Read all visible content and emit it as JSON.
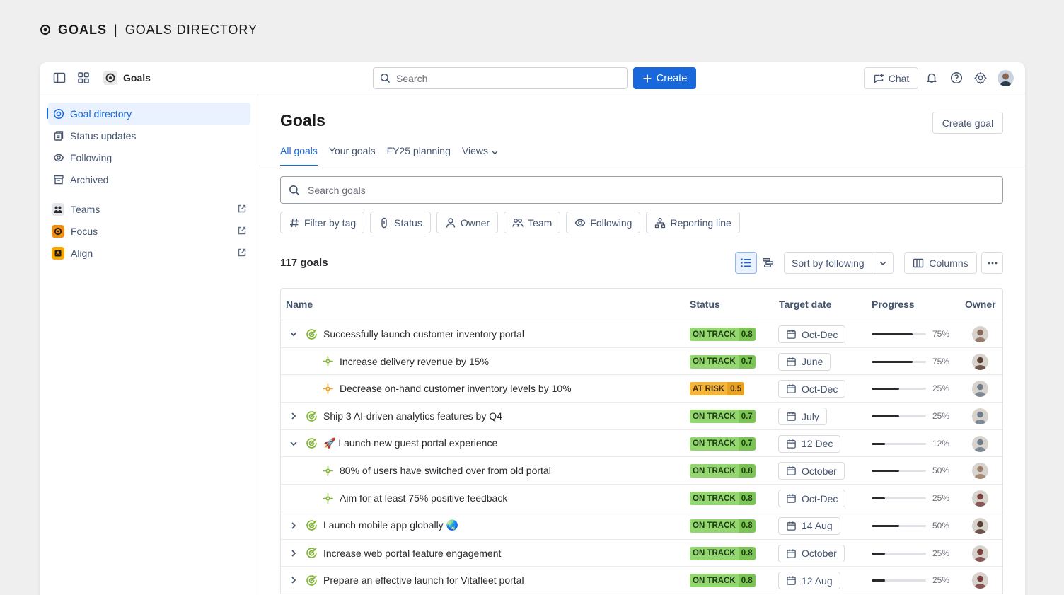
{
  "slide": {
    "title_bold": "GOALS",
    "separator": "|",
    "title_rest": "GOALS DIRECTORY"
  },
  "topbar": {
    "app_name": "Goals",
    "search_placeholder": "Search",
    "create_label": "Create",
    "chat_label": "Chat"
  },
  "sidebar": {
    "items": [
      {
        "label": "Goal directory",
        "icon": "goal-icon",
        "active": true
      },
      {
        "label": "Status updates",
        "icon": "status-updates-icon"
      },
      {
        "label": "Following",
        "icon": "eye-icon"
      },
      {
        "label": "Archived",
        "icon": "archive-icon"
      }
    ],
    "apps": [
      {
        "label": "Teams",
        "icon": "teams-icon"
      },
      {
        "label": "Focus",
        "icon": "focus-icon",
        "color": "#f18d13"
      },
      {
        "label": "Align",
        "icon": "align-icon",
        "color": "#fca700"
      }
    ]
  },
  "main": {
    "title": "Goals",
    "create_goal_label": "Create goal",
    "tabs": [
      {
        "label": "All goals",
        "active": true
      },
      {
        "label": "Your goals"
      },
      {
        "label": "FY25 planning"
      },
      {
        "label": "Views"
      }
    ],
    "search_placeholder": "Search goals",
    "filters": [
      {
        "label": "Filter by tag",
        "icon": "hash-icon"
      },
      {
        "label": "Status",
        "icon": "status-icon"
      },
      {
        "label": "Owner",
        "icon": "person-icon"
      },
      {
        "label": "Team",
        "icon": "team-icon"
      },
      {
        "label": "Following",
        "icon": "eye-icon"
      },
      {
        "label": "Reporting line",
        "icon": "hierarchy-icon"
      }
    ],
    "count_label": "117 goals",
    "sort_label": "Sort by following",
    "columns_label": "Columns"
  },
  "table": {
    "headers": {
      "name": "Name",
      "status": "Status",
      "target_date": "Target date",
      "progress": "Progress",
      "owner": "Owner"
    },
    "rows": [
      {
        "name": "Successfully launch customer inventory portal",
        "level": 0,
        "caret": "down",
        "status": "ON TRACK",
        "score": "0.8",
        "state": "ontrack",
        "date": "Oct-Dec",
        "pct": "75%",
        "progress": 0.75,
        "avatar": "#8a6a5a"
      },
      {
        "name": "Increase delivery revenue by 15%",
        "level": 1,
        "status": "ON TRACK",
        "score": "0.7",
        "state": "ontrack",
        "date": "June",
        "pct": "75%",
        "progress": 0.75,
        "avatar": "#5a3f34"
      },
      {
        "name": "Decrease on-hand customer inventory levels by 10%",
        "level": 1,
        "status": "AT RISK",
        "score": "0.5",
        "state": "atrisk",
        "date": "Oct-Dec",
        "pct": "25%",
        "progress": 0.5,
        "avatar": "#6f7c8a"
      },
      {
        "name": "Ship 3 AI-driven analytics features by Q4",
        "level": 0,
        "caret": "right",
        "status": "ON TRACK",
        "score": "0.7",
        "state": "ontrack",
        "date": "July",
        "pct": "25%",
        "progress": 0.5,
        "avatar": "#6f7c8a"
      },
      {
        "name": "🚀 Launch new guest portal experience",
        "level": 0,
        "caret": "down",
        "status": "ON TRACK",
        "score": "0.7",
        "state": "ontrack",
        "date": "12 Dec",
        "pct": "12%",
        "progress": 0.25,
        "avatar": "#6f7c8a"
      },
      {
        "name": "80% of users have switched over from old portal",
        "level": 1,
        "status": "ON TRACK",
        "score": "0.8",
        "state": "ontrack",
        "date": "October",
        "pct": "50%",
        "progress": 0.5,
        "avatar": "#a07e6a"
      },
      {
        "name": "Aim for at least 75% positive feedback",
        "level": 1,
        "status": "ON TRACK",
        "score": "0.8",
        "state": "ontrack",
        "date": "Oct-Dec",
        "pct": "25%",
        "progress": 0.25,
        "avatar": "#7a3f3f"
      },
      {
        "name": "Launch mobile app globally 🌏",
        "level": 0,
        "caret": "right",
        "status": "ON TRACK",
        "score": "0.8",
        "state": "ontrack",
        "date": "14 Aug",
        "pct": "50%",
        "progress": 0.5,
        "avatar": "#5a3f34"
      },
      {
        "name": "Increase web portal feature engagement",
        "level": 0,
        "caret": "right",
        "status": "ON TRACK",
        "score": "0.8",
        "state": "ontrack",
        "date": "October",
        "pct": "25%",
        "progress": 0.25,
        "avatar": "#7a3f3f"
      },
      {
        "name": "Prepare an effective launch for Vitafleet portal",
        "level": 0,
        "caret": "right",
        "status": "ON TRACK",
        "score": "0.8",
        "state": "ontrack",
        "date": "12 Aug",
        "pct": "25%",
        "progress": 0.25,
        "avatar": "#7a3f3f"
      }
    ]
  }
}
